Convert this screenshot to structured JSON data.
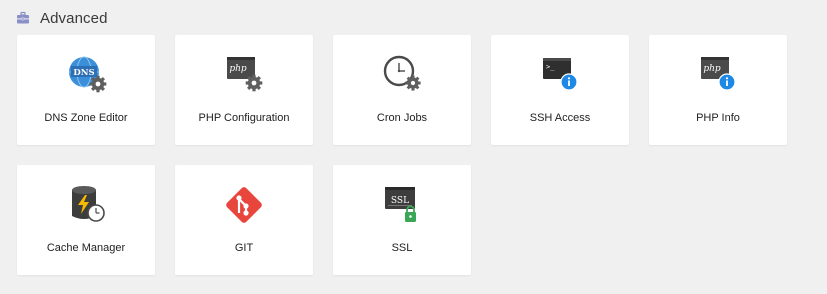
{
  "section": {
    "title": "Advanced",
    "icon": "toolbox-icon"
  },
  "tools": [
    {
      "label": "DNS Zone Editor",
      "icon": "dns-gear-icon",
      "icon_text": "DNS"
    },
    {
      "label": "PHP Configuration",
      "icon": "php-gear-icon",
      "icon_text": "php"
    },
    {
      "label": "Cron Jobs",
      "icon": "clock-gear-icon"
    },
    {
      "label": "SSH Access",
      "icon": "terminal-info-icon",
      "icon_text": ">_"
    },
    {
      "label": "PHP Info",
      "icon": "php-info-icon",
      "icon_text": "php"
    },
    {
      "label": "Cache Manager",
      "icon": "database-clock-icon"
    },
    {
      "label": "GIT",
      "icon": "git-icon"
    },
    {
      "label": "SSL",
      "icon": "ssl-lock-icon",
      "icon_text": "SSL"
    }
  ],
  "colors": {
    "page_bg": "#f0f0f0",
    "card_bg": "#ffffff",
    "icon_dark": "#4a4a4a",
    "gear_gray": "#5f5f5f",
    "dns_blue": "#3b8fd9",
    "info_blue": "#1e88e5",
    "git_red": "#e8453c",
    "ssl_green": "#3aa757",
    "bolt_yellow": "#f5b800",
    "header_icon": "#8b8fc7"
  }
}
